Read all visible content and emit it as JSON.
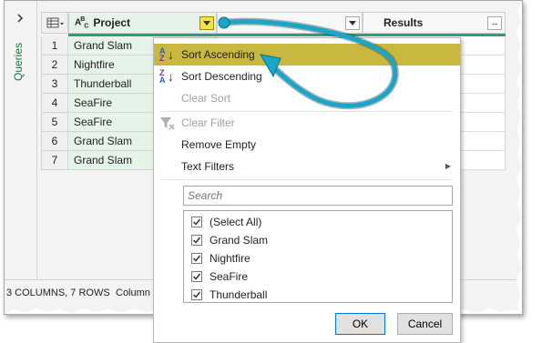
{
  "sidebar": {
    "label": "Queries"
  },
  "grid": {
    "columns": [
      {
        "label": "Project",
        "type_icon": "abc-type-icon"
      },
      {
        "label": ""
      },
      {
        "label": "Results"
      }
    ],
    "rows": [
      {
        "num": "1",
        "project": "Grand Slam"
      },
      {
        "num": "2",
        "project": "Nightfire"
      },
      {
        "num": "3",
        "project": "Thunderball"
      },
      {
        "num": "4",
        "project": "SeaFire"
      },
      {
        "num": "5",
        "project": "SeaFire"
      },
      {
        "num": "6",
        "project": "Grand Slam"
      },
      {
        "num": "7",
        "project": "Grand Slam"
      }
    ]
  },
  "status": {
    "summary": "3 COLUMNS, 7 ROWS",
    "column_hint": "Column p"
  },
  "menu": {
    "sort_ascending": "Sort Ascending",
    "sort_descending": "Sort Descending",
    "clear_sort": "Clear Sort",
    "clear_filter": "Clear Filter",
    "remove_empty": "Remove Empty",
    "text_filters": "Text Filters",
    "search_placeholder": "Search",
    "values": [
      {
        "label": "(Select All)",
        "checked": true
      },
      {
        "label": "Grand Slam",
        "checked": true
      },
      {
        "label": "Nightfire",
        "checked": true
      },
      {
        "label": "SeaFire",
        "checked": true
      },
      {
        "label": "Thunderball",
        "checked": true
      }
    ],
    "ok": "OK",
    "cancel": "Cancel"
  },
  "colors": {
    "accent_green": "#2e9e7a",
    "highlight": "#c9b83f",
    "arrow": "#1aa6c8"
  }
}
